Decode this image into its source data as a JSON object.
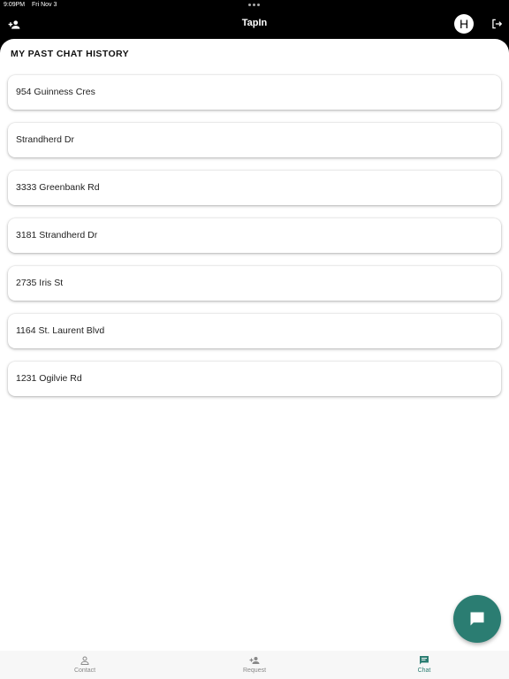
{
  "status_bar": {
    "time": "9:09PM",
    "date": "Fri Nov 3"
  },
  "header": {
    "title": "TapIn",
    "avatar_initial": "H"
  },
  "section_title": "MY PAST CHAT HISTORY",
  "chats": [
    {
      "address": "954 Guinness Cres"
    },
    {
      "address": "Strandherd Dr"
    },
    {
      "address": "3333 Greenbank Rd"
    },
    {
      "address": "3181 Strandherd Dr"
    },
    {
      "address": "2735 Iris St"
    },
    {
      "address": "1164 St. Laurent Blvd"
    },
    {
      "address": "1231 Ogilvie Rd"
    }
  ],
  "bottom_nav": [
    {
      "label": "Contact",
      "icon": "person-icon",
      "active": false
    },
    {
      "label": "Request",
      "icon": "person-add-icon",
      "active": false
    },
    {
      "label": "Chat",
      "icon": "chat-icon",
      "active": true
    }
  ],
  "colors": {
    "accent": "#2b7d72",
    "header_bg": "#000000",
    "content_bg": "#ffffff"
  }
}
